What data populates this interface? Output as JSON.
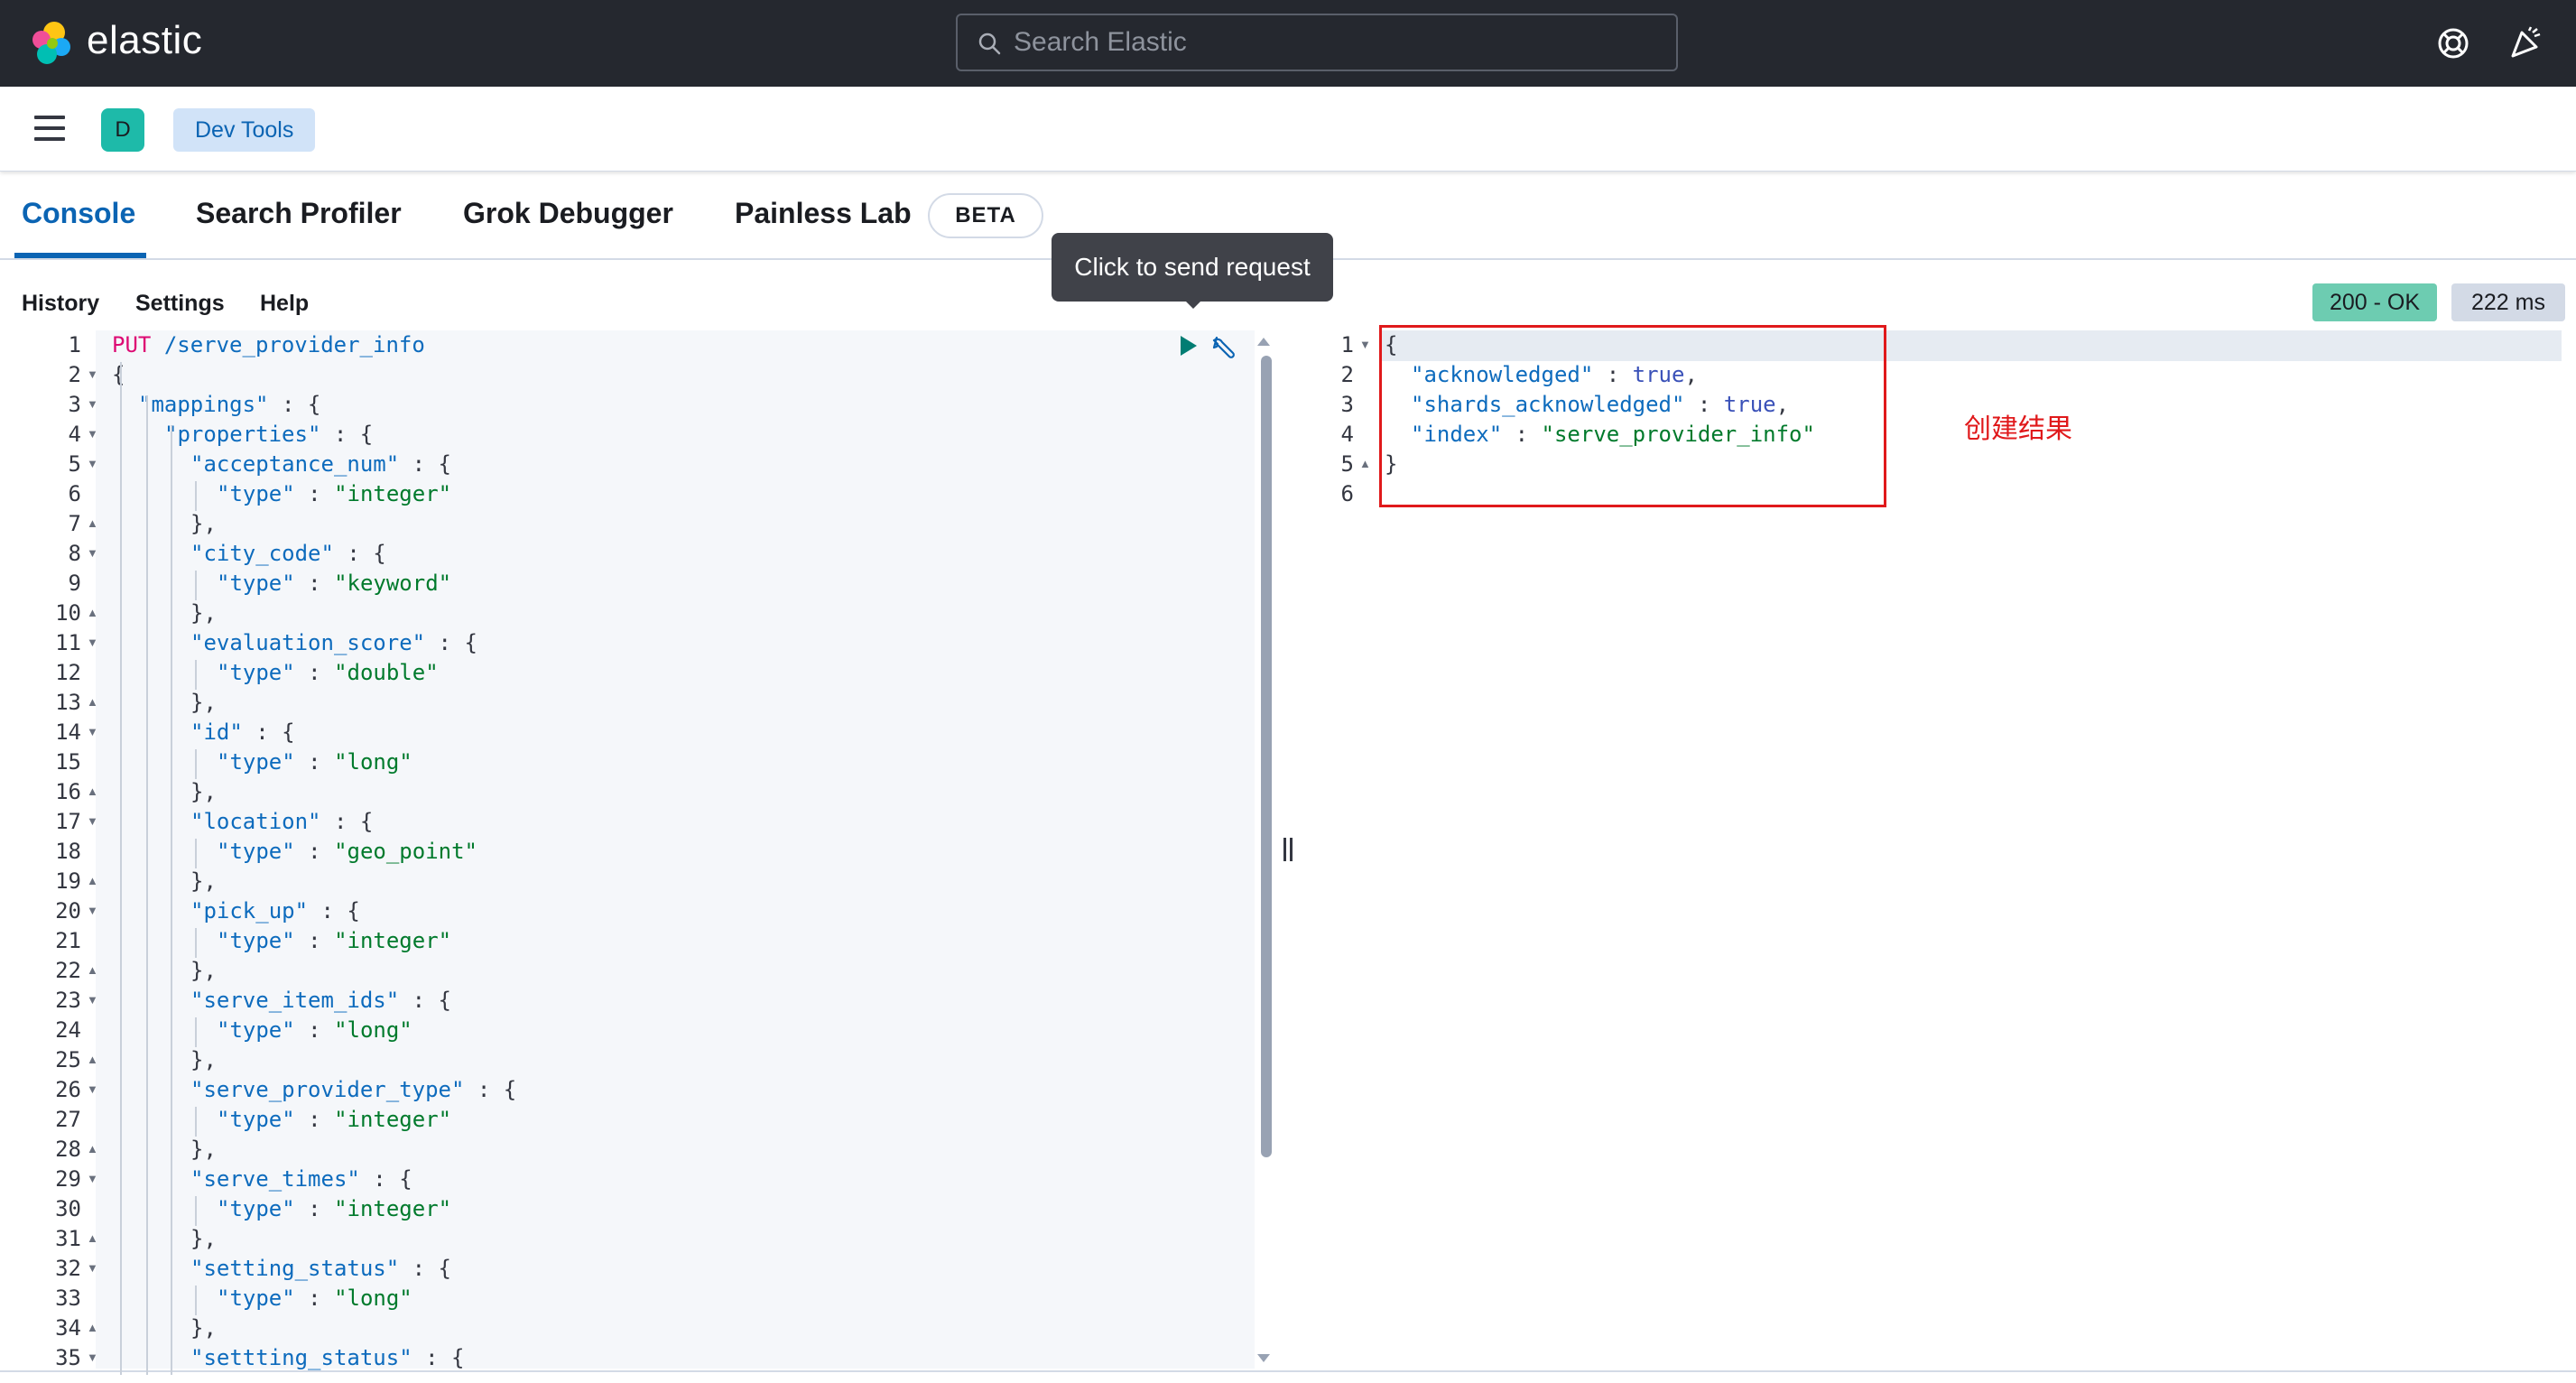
{
  "header": {
    "logo_text": "elastic",
    "search_placeholder": "Search Elastic"
  },
  "subbar": {
    "space_letter": "D",
    "breadcrumb": "Dev Tools"
  },
  "tabs": [
    {
      "label": "Console",
      "active": true
    },
    {
      "label": "Search Profiler",
      "active": false
    },
    {
      "label": "Grok Debugger",
      "active": false
    },
    {
      "label": "Painless Lab",
      "active": false
    }
  ],
  "beta_badge": "BETA",
  "tooltip": "Click to send request",
  "console_menu": [
    "History",
    "Settings",
    "Help"
  ],
  "status": {
    "code": "200 - OK",
    "time": "222 ms"
  },
  "request": {
    "method": "PUT",
    "path": "/serve_provider_info",
    "lines": [
      {
        "n": "1",
        "fold": ""
      },
      {
        "n": "2",
        "fold": "down"
      },
      {
        "n": "3",
        "fold": "down"
      },
      {
        "n": "4",
        "fold": "down"
      },
      {
        "n": "5",
        "fold": "down"
      },
      {
        "n": "6",
        "fold": ""
      },
      {
        "n": "7",
        "fold": "up"
      },
      {
        "n": "8",
        "fold": "down"
      },
      {
        "n": "9",
        "fold": ""
      },
      {
        "n": "10",
        "fold": "up"
      },
      {
        "n": "11",
        "fold": "down"
      },
      {
        "n": "12",
        "fold": ""
      },
      {
        "n": "13",
        "fold": "up"
      },
      {
        "n": "14",
        "fold": "down"
      },
      {
        "n": "15",
        "fold": ""
      },
      {
        "n": "16",
        "fold": "up"
      },
      {
        "n": "17",
        "fold": "down"
      },
      {
        "n": "18",
        "fold": ""
      },
      {
        "n": "19",
        "fold": "up"
      },
      {
        "n": "20",
        "fold": "down"
      },
      {
        "n": "21",
        "fold": ""
      },
      {
        "n": "22",
        "fold": "up"
      },
      {
        "n": "23",
        "fold": "down"
      },
      {
        "n": "24",
        "fold": ""
      },
      {
        "n": "25",
        "fold": "up"
      },
      {
        "n": "26",
        "fold": "down"
      },
      {
        "n": "27",
        "fold": ""
      },
      {
        "n": "28",
        "fold": "up"
      },
      {
        "n": "29",
        "fold": "down"
      },
      {
        "n": "30",
        "fold": ""
      },
      {
        "n": "31",
        "fold": "up"
      },
      {
        "n": "32",
        "fold": "down"
      },
      {
        "n": "33",
        "fold": ""
      },
      {
        "n": "34",
        "fold": "up"
      },
      {
        "n": "35",
        "fold": "down"
      }
    ],
    "fields": [
      {
        "name": "\"acceptance_num\"",
        "type": "\"integer\""
      },
      {
        "name": "\"city_code\"",
        "type": "\"keyword\""
      },
      {
        "name": "\"evaluation_score\"",
        "type": "\"double\""
      },
      {
        "name": "\"id\"",
        "type": "\"long\""
      },
      {
        "name": "\"location\"",
        "type": "\"geo_point\""
      },
      {
        "name": "\"pick_up\"",
        "type": "\"integer\""
      },
      {
        "name": "\"serve_item_ids\"",
        "type": "\"long\""
      },
      {
        "name": "\"serve_provider_type\"",
        "type": "\"integer\""
      },
      {
        "name": "\"serve_times\"",
        "type": "\"integer\""
      },
      {
        "name": "\"setting_status\"",
        "type": "\"long\""
      }
    ],
    "last_field": "\"settting_status\"",
    "mappings_key": "\"mappings\"",
    "properties_key": "\"properties\"",
    "type_key": "\"type\""
  },
  "response": {
    "lines": [
      {
        "n": "1",
        "fold": "down"
      },
      {
        "n": "2",
        "fold": ""
      },
      {
        "n": "3",
        "fold": ""
      },
      {
        "n": "4",
        "fold": ""
      },
      {
        "n": "5",
        "fold": "up"
      },
      {
        "n": "6",
        "fold": ""
      }
    ],
    "ack_key": "\"acknowledged\"",
    "ack_val": "true",
    "shards_key": "\"shards_acknowledged\"",
    "shards_val": "true",
    "index_key": "\"index\"",
    "index_val": "\"serve_provider_info\""
  },
  "annotation": "创建结果",
  "colors": {
    "accent": "#0b64b3",
    "status_ok": "#6dccb1",
    "annotation_red": "#e0191b",
    "header_bg": "#25282f"
  }
}
